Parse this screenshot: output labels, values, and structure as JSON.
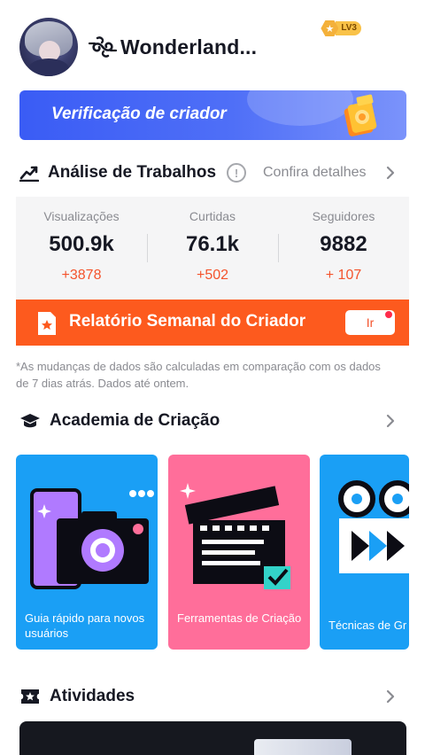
{
  "profile": {
    "username": "Wonderland...",
    "level_label": "LV3"
  },
  "banner": {
    "text": "Verificação de criador"
  },
  "analysis": {
    "title": "Análise de Trabalhos",
    "details_link": "Confira detalhes",
    "stats": [
      {
        "label": "Visualizações",
        "value": "500.9k",
        "delta": "+3878"
      },
      {
        "label": "Curtidas",
        "value": "76.1k",
        "delta": "+502"
      },
      {
        "label": "Seguidores",
        "value": "9882",
        "delta": "+ 107"
      }
    ]
  },
  "report": {
    "text": "Relatório Semanal do Criador",
    "button_label": "Ir"
  },
  "note": "*As mudanças de dados são calculadas em comparação com os dados de 7 dias atrás. Dados até ontem.",
  "academy": {
    "title": "Academia de Criação",
    "cards": [
      {
        "label": "Guia rápido para novos usuários",
        "icon": "camera-phone-icon"
      },
      {
        "label": "Ferramentas de Criação",
        "icon": "clapperboard-icon"
      },
      {
        "label": "Técnicas de Gr",
        "icon": "film-reel-icon"
      }
    ]
  },
  "activities": {
    "title": "Atividades"
  },
  "colors": {
    "accent_orange": "#fd5a1e",
    "delta_red": "#f4532c",
    "banner_blue": "#3a5cf5",
    "card_blue": "#1a9ff5",
    "card_pink": "#ff6e9a"
  }
}
